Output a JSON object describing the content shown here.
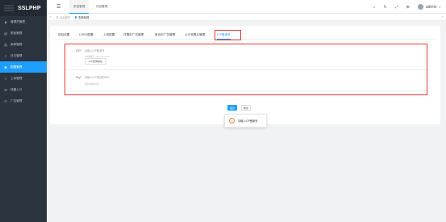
{
  "app": {
    "logo_text": "SSLPHP"
  },
  "sidebar": {
    "items": [
      {
        "label": "管理员管理",
        "icon": "user-icon"
      },
      {
        "label": "角色管理",
        "icon": "role-icon"
      },
      {
        "label": "菜单管理",
        "icon": "menu-icon"
      },
      {
        "label": "日志管理",
        "icon": "log-icon"
      },
      {
        "label": "配置管理",
        "icon": "gear-icon",
        "active": true
      },
      {
        "label": "上传管理",
        "icon": "upload-icon"
      },
      {
        "label": "快捷入口",
        "icon": "shortcut-icon"
      },
      {
        "label": "广告管理",
        "icon": "ad-icon"
      }
    ]
  },
  "topbar": {
    "tabs": [
      "系统管理",
      "内容管理"
    ],
    "icons": [
      "home-icon",
      "refresh-icon",
      "fullscreen-icon",
      "lock-icon"
    ],
    "user": "admin"
  },
  "pagetabs": {
    "tabs": [
      {
        "label": "后台首页"
      },
      {
        "label": "配置管理",
        "active": true
      }
    ]
  },
  "config": {
    "tabs": [
      "网站设置",
      "LOGO配置",
      "上传配置",
      "详情页广告管理",
      "首页页广告管理",
      "公众号图片管理",
      "ICP备案号"
    ],
    "active_tab": 6,
    "fields": {
      "icp_label": "ICP",
      "icp_placeholder": "请输入ICP备案号",
      "icp_hint": "ICP备案号：xxxx-xxxx-xxx",
      "icp_button": "ICP查询地址",
      "key_label": "Key",
      "key_placeholder": "请输入ICP申请的KEY",
      "key_hint": "备案查询的KEY"
    },
    "submit_label": "提交",
    "reset_label": "重置"
  },
  "toast": {
    "message": "请输入ICP备案号"
  },
  "colors": {
    "accent": "#1e9fff",
    "sidebar_bg": "#2b333e",
    "highlight": "#e53935",
    "warning": "#f0883a"
  }
}
